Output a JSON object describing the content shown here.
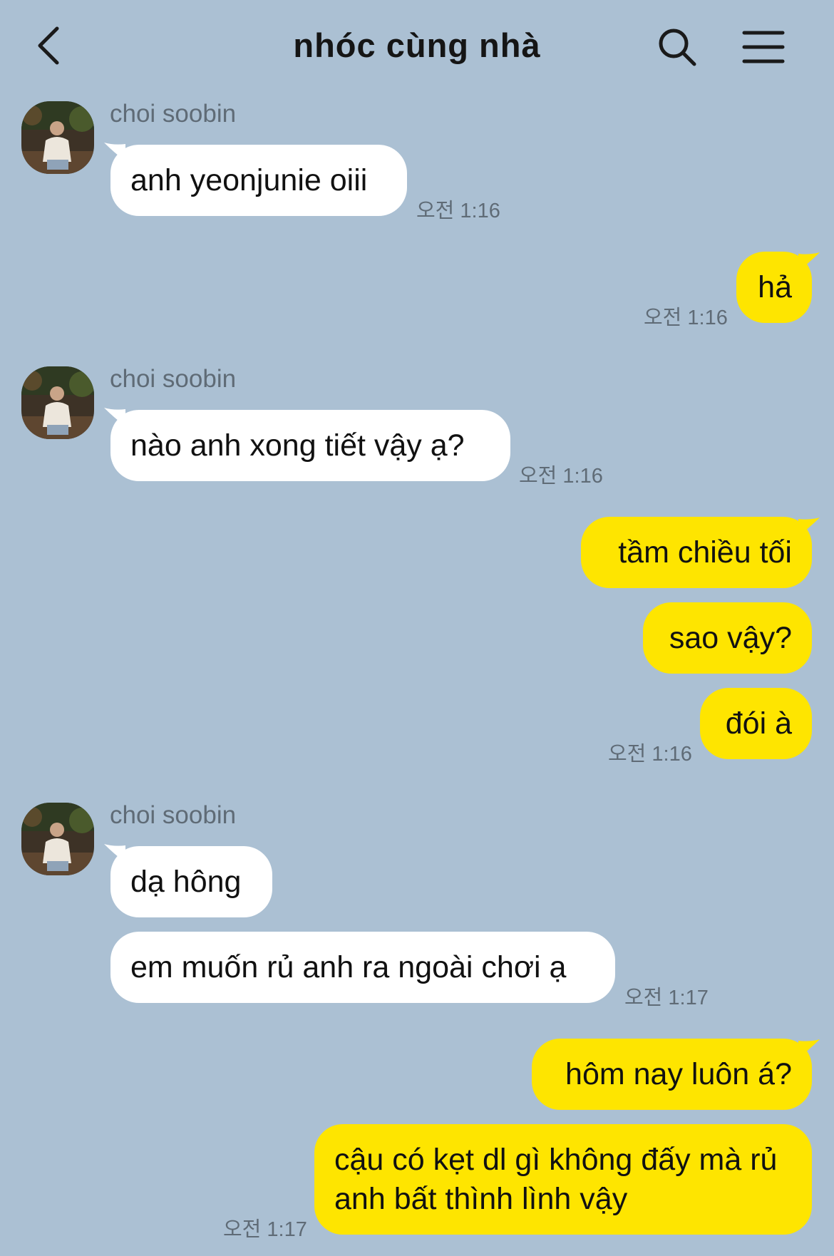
{
  "header": {
    "title": "nhóc cùng nhà",
    "back_icon": "chevron-left-icon",
    "search_icon": "search-icon",
    "menu_icon": "hamburger-menu-icon"
  },
  "colors": {
    "background": "#abc0d3",
    "incoming": "#ffffff",
    "outgoing": "#fee500"
  },
  "messages": [
    {
      "group": "in",
      "sender": "choi soobin",
      "texts": [
        "anh yeonjunie oiii"
      ],
      "time": "오전 1:16"
    },
    {
      "group": "out",
      "texts": [
        "hả"
      ],
      "time": "오전 1:16"
    },
    {
      "group": "in",
      "sender": "choi soobin",
      "texts": [
        "nào anh xong tiết vậy ạ?"
      ],
      "time": "오전 1:16"
    },
    {
      "group": "out",
      "texts": [
        "tầm chiều tối",
        "sao vậy?",
        "đói à"
      ],
      "time": "오전 1:16"
    },
    {
      "group": "in",
      "sender": "choi soobin",
      "texts": [
        "dạ hông",
        "em muốn rủ anh ra ngoài chơi ạ"
      ],
      "time": "오전 1:17"
    },
    {
      "group": "out",
      "texts": [
        "hôm nay luôn á?",
        "cậu có kẹt dl gì không đấy mà rủ anh bất thình lình vậy"
      ],
      "time": "오전 1:17"
    }
  ]
}
